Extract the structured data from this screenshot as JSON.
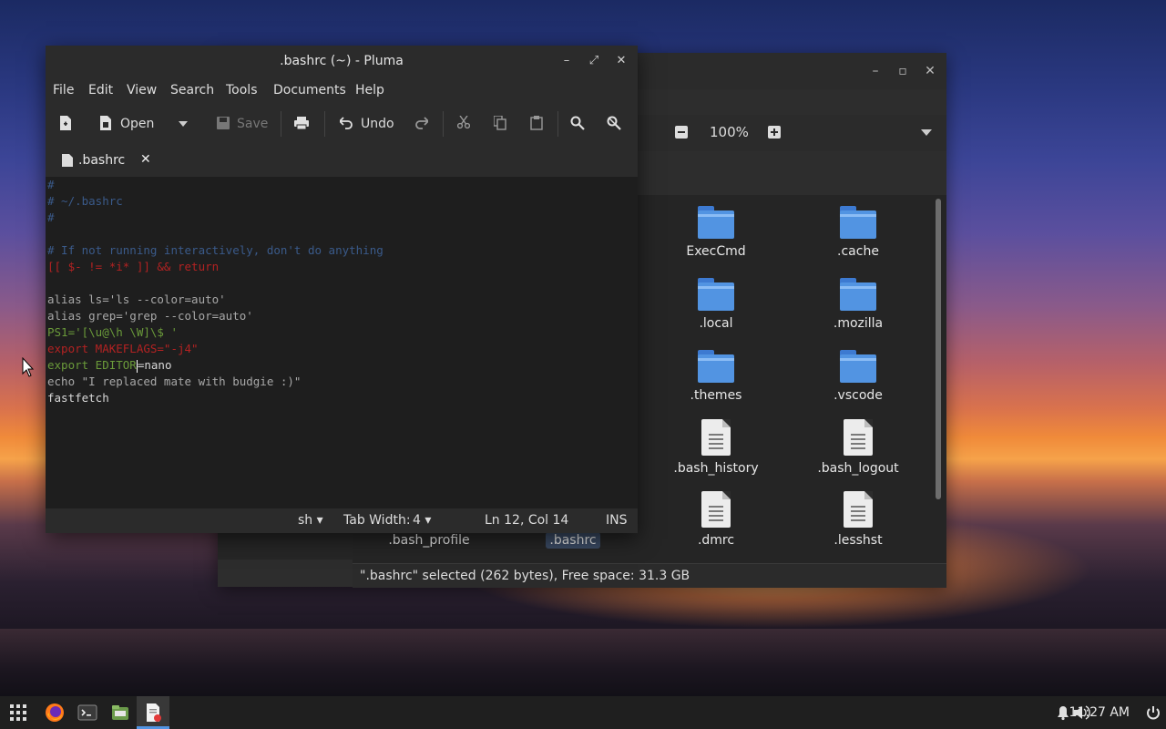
{
  "editor": {
    "title": ".bashrc (~) - Pluma",
    "menu": [
      "File",
      "Edit",
      "View",
      "Search",
      "Tools",
      "Documents",
      "Help"
    ],
    "toolbar": {
      "open": "Open",
      "save": "Save",
      "undo": "Undo"
    },
    "tab": ".bashrc",
    "code": [
      "#",
      "# ~/.bashrc",
      "#",
      "",
      "# If not running interactively, don't do anything",
      "[[ $- != *i* ]] && return",
      "",
      "alias ls='ls --color=auto'",
      "alias grep='grep --color=auto'",
      "PS1='[\\u@\\h \\W]\\$ '",
      "export MAKEFLAGS=\"-j4\"",
      "export EDITOR=nano",
      "echo \"I replaced mate with budgie :)\"",
      "fastfetch"
    ],
    "status": {
      "lang": "sh",
      "tab_width_label": "Tab Width:",
      "tab_width": "4",
      "position": "Ln 12, Col 14",
      "mode": "INS"
    }
  },
  "file_manager": {
    "zoom": "100%",
    "items": [
      {
        "name": "ExecCmd",
        "kind": "folder"
      },
      {
        "name": ".cache",
        "kind": "folder"
      },
      {
        "name": ".local",
        "kind": "folder"
      },
      {
        "name": ".mozilla",
        "kind": "folder"
      },
      {
        "name": ".themes",
        "kind": "folder"
      },
      {
        "name": ".vscode",
        "kind": "folder"
      },
      {
        "name": ".bash_history",
        "kind": "file"
      },
      {
        "name": ".bash_logout",
        "kind": "file"
      },
      {
        "name": ".dmrc",
        "kind": "file"
      },
      {
        "name": ".lesshst",
        "kind": "file"
      }
    ],
    "bottom_row": [
      ".bash_profile",
      ".bashrc"
    ],
    "status": "\".bashrc\" selected (262 bytes), Free space: 31.3 GB"
  },
  "panel": {
    "clock": "11:27 AM"
  },
  "colors": {
    "accent": "#5294e2",
    "folder": "#5294e2"
  }
}
